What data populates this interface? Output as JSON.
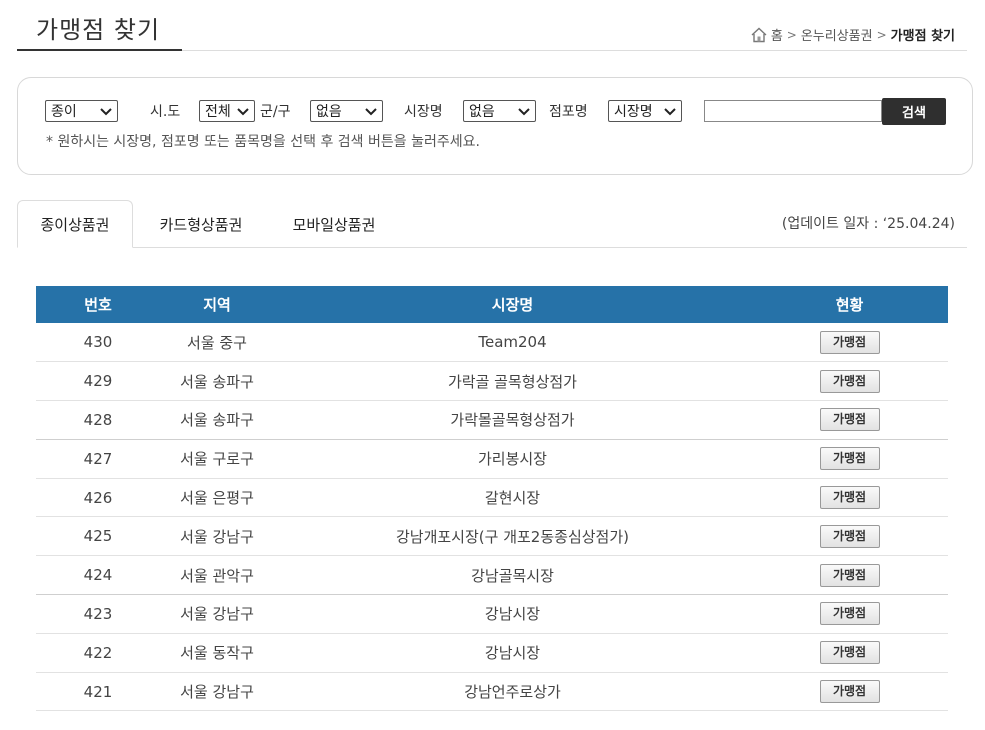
{
  "page": {
    "title": "가맹점 찾기"
  },
  "breadcrumb": {
    "home": "홈",
    "level1": "온누리상품권",
    "current": "가맹점 찾기",
    "separator": ">"
  },
  "search": {
    "type_select": "종이",
    "sido_label": "시.도",
    "sido_select": "전체",
    "gungu_label": "군/구",
    "gungu_select": "없음",
    "market_label": "시장명",
    "market_select": "없음",
    "store_label": "점포명",
    "keyword_type_select": "시장명",
    "keyword_value": "",
    "button_label": "검색",
    "hint": "* 원하시는 시장명, 점포명 또는 품목명을 선택 후 검색 버튼을 눌러주세요."
  },
  "tabs": [
    {
      "label": "종이상품권",
      "active": true
    },
    {
      "label": "카드형상품권",
      "active": false
    },
    {
      "label": "모바일상품권",
      "active": false
    }
  ],
  "update_note": "(업데이트 일자 : ‘25.04.24)",
  "table": {
    "headers": [
      "번호",
      "지역",
      "시장명",
      "현황"
    ],
    "button_label": "가맹점",
    "rows": [
      {
        "no": "430",
        "region": "서울 중구",
        "market": "Team204"
      },
      {
        "no": "429",
        "region": "서울 송파구",
        "market": "가락골 골목형상점가"
      },
      {
        "no": "428",
        "region": "서울 송파구",
        "market": "가락몰골목형상점가"
      },
      {
        "no": "427",
        "region": "서울 구로구",
        "market": "가리봉시장"
      },
      {
        "no": "426",
        "region": "서울 은평구",
        "market": "갈현시장"
      },
      {
        "no": "425",
        "region": "서울 강남구",
        "market": "강남개포시장(구 개포2동종심상점가)"
      },
      {
        "no": "424",
        "region": "서울 관악구",
        "market": "강남골목시장"
      },
      {
        "no": "423",
        "region": "서울 강남구",
        "market": "강남시장"
      },
      {
        "no": "422",
        "region": "서울 동작구",
        "market": "강남시장"
      },
      {
        "no": "421",
        "region": "서울 강남구",
        "market": "강남언주로상가"
      }
    ]
  },
  "colors": {
    "table_header": "#2672a8",
    "search_button": "#2f2f2f"
  }
}
